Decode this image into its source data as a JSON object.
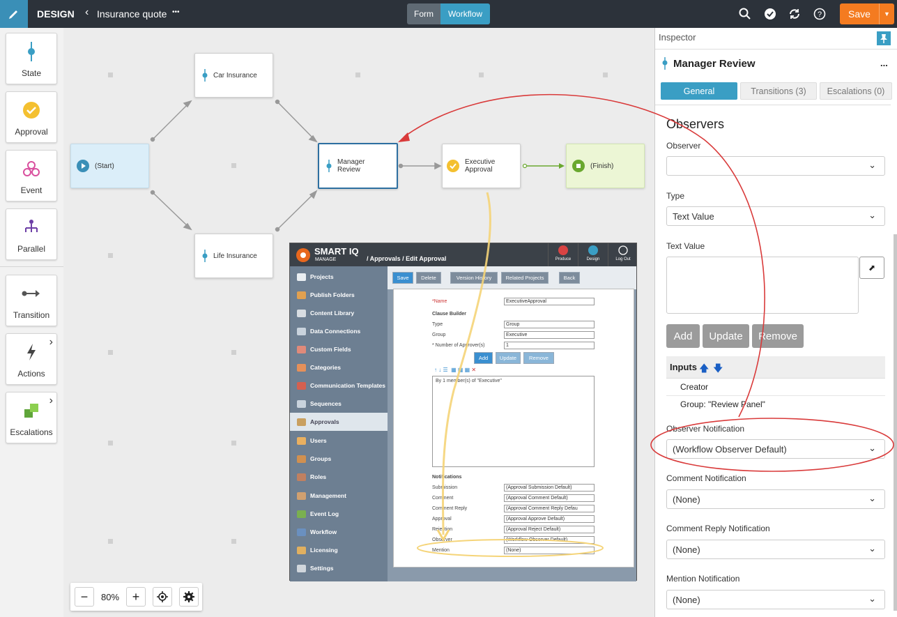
{
  "topbar": {
    "brand": "DESIGN",
    "breadcrumb": "Insurance quote",
    "more": "•••",
    "tabs": [
      "Form",
      "Workflow"
    ],
    "active_tab": "Workflow",
    "save_label": "Save",
    "icons": [
      "search-icon",
      "check-circle-icon",
      "refresh-icon",
      "help-icon"
    ]
  },
  "toolbox": {
    "items": [
      {
        "label": "State",
        "icon": "state-icon"
      },
      {
        "label": "Approval",
        "icon": "approval-check-icon"
      },
      {
        "label": "Event",
        "icon": "event-icon"
      },
      {
        "label": "Parallel",
        "icon": "parallel-icon"
      },
      {
        "label": "Transition",
        "icon": "transition-arrow-icon"
      },
      {
        "label": "Actions",
        "icon": "lightning-icon"
      },
      {
        "label": "Escalations",
        "icon": "escalations-icon"
      }
    ]
  },
  "workflow": {
    "nodes": {
      "start": "(Start)",
      "car": "Car Insurance",
      "life": "Life Insurance",
      "manager": "Manager Review",
      "executive": "Executive Approval",
      "finish": "(Finish)"
    },
    "zoom_level": "80%"
  },
  "embedded": {
    "logo": "SMART IQ",
    "logo_sub": "MANAGE",
    "path": "/ Approvals / Edit Approval",
    "head_buttons": [
      "Produce",
      "Design",
      "Log Out"
    ],
    "sidebar": [
      "Projects",
      "Publish Folders",
      "Content Library",
      "Data Connections",
      "Custom Fields",
      "Categories",
      "Communication Templates",
      "Sequences",
      "Approvals",
      "Users",
      "Groups",
      "Roles",
      "Management",
      "Event Log",
      "Workflow",
      "Licensing",
      "Settings"
    ],
    "active_sidebar": "Approvals",
    "toolbar": [
      "Save",
      "Delete",
      "Version History",
      "Related Projects",
      "Back"
    ],
    "form": {
      "name_label": "*Name",
      "name_value": "ExecutiveApproval",
      "clause_builder": "Clause Builder",
      "type_label": "Type",
      "type_value": "Group",
      "group_label": "Group",
      "group_value": "Executive",
      "approvers_label": "* Number of Approver(s)",
      "approvers_value": "1",
      "buttons": [
        "Add",
        "Update",
        "Remove"
      ],
      "clause_text": "By 1 member(s) of \"Executive\"",
      "notifications_title": "Notifications",
      "notifications": [
        {
          "label": "Submission",
          "value": "(Approval Submission Default)"
        },
        {
          "label": "Comment",
          "value": "(Approval Comment Default)"
        },
        {
          "label": "Comment Reply",
          "value": "(Approval Comment Reply Defau"
        },
        {
          "label": "Approval",
          "value": "(Approval Approve Default)"
        },
        {
          "label": "Rejection",
          "value": "(Approval Reject Default)"
        },
        {
          "label": "Observer",
          "value": "(Workflow Observer Default)"
        },
        {
          "label": "Mention",
          "value": "(None)"
        }
      ]
    }
  },
  "inspector": {
    "header": "Inspector",
    "title": "Manager Review",
    "more": "...",
    "tabs": [
      "General",
      "Transitions (3)",
      "Escalations (0)"
    ],
    "active_tab": "General",
    "section": "Observers",
    "observer_label": "Observer",
    "observer_value": "",
    "type_label": "Type",
    "type_value": "Text Value",
    "text_value_label": "Text Value",
    "buttons": [
      "Add",
      "Update",
      "Remove"
    ],
    "inputs_header": "Inputs",
    "inputs": [
      "Creator",
      "Group: \"Review Panel\""
    ],
    "observer_notification_label": "Observer Notification",
    "observer_notification_value": "(Workflow Observer Default)",
    "comment_notification_label": "Comment Notification",
    "comment_notification_value": "(None)",
    "comment_reply_label": "Comment Reply Notification",
    "comment_reply_value": "(None)",
    "mention_label": "Mention Notification",
    "mention_value": "(None)"
  },
  "colors": {
    "accent_blue": "#3a9ec4",
    "save_orange": "#f47b20",
    "annotation_red": "#d93a3a",
    "annotation_yellow": "#f7d87a",
    "start_fill": "#dbeef9",
    "finish_fill": "#ecf6d5"
  }
}
